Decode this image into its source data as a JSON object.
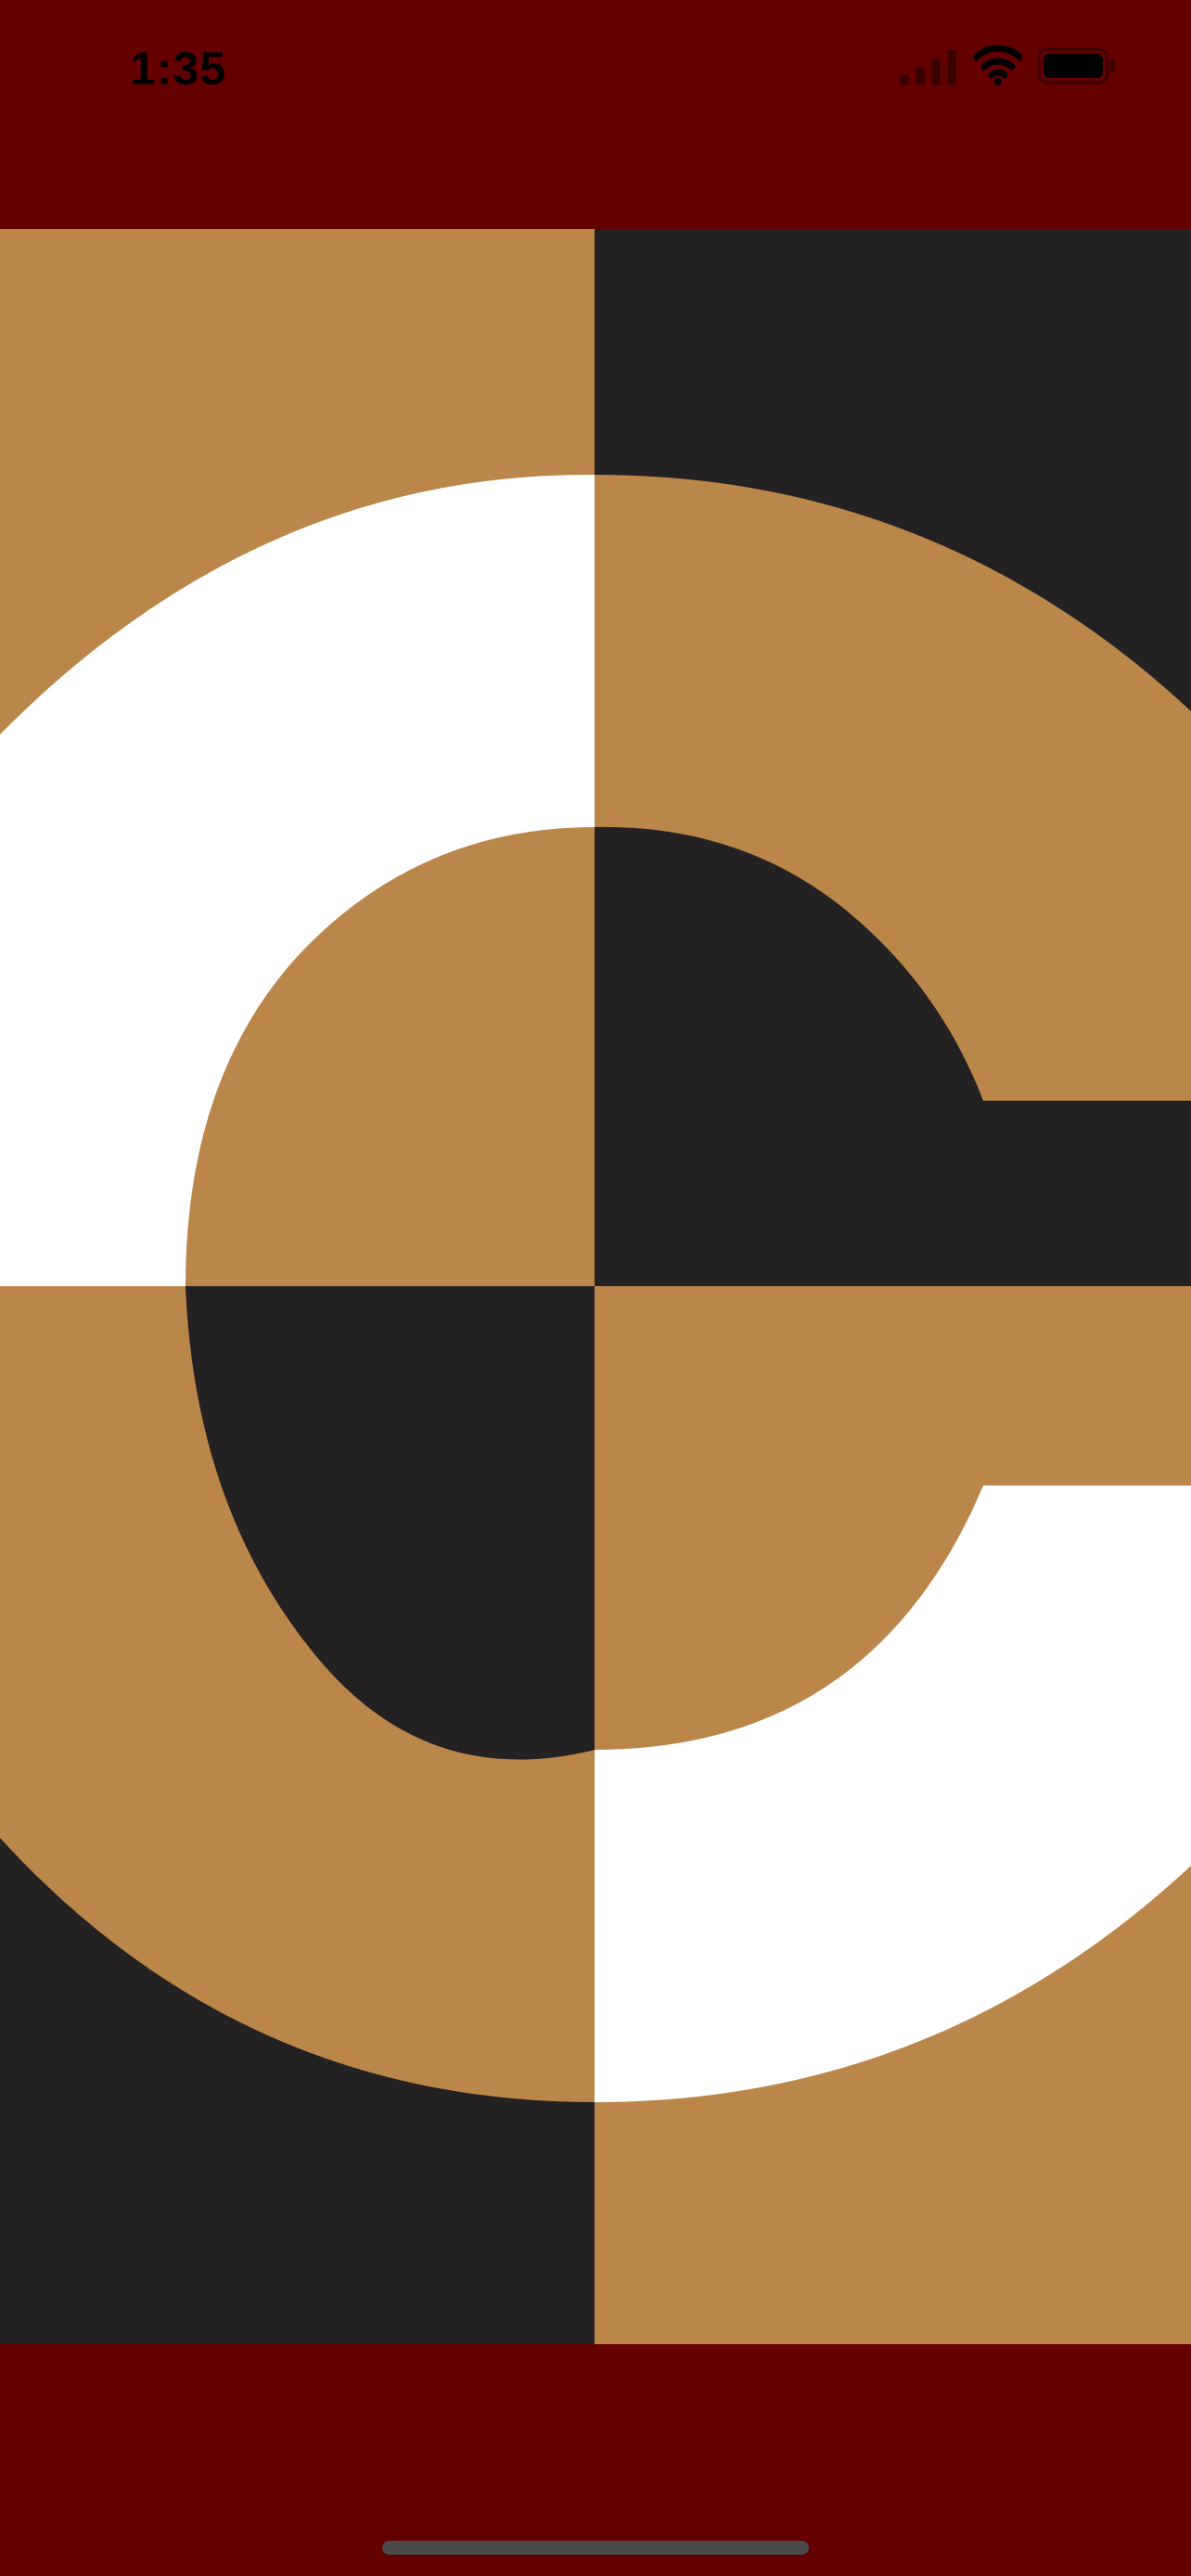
{
  "status_bar": {
    "time": "1:35",
    "icons": [
      "cellular-signal-icon",
      "wifi-icon",
      "battery-icon"
    ]
  },
  "colors": {
    "background": "#650000",
    "gold": "#BB8649",
    "dark": "#232122",
    "white": "#FFFFFF",
    "home_indicator": "#4A4A4A"
  },
  "artwork": {
    "subject": "letter-c-quadrant-artwork",
    "quadrant_colors": {
      "top_left": "gold",
      "top_right": "dark",
      "bottom_left": "dark",
      "bottom_right": "gold"
    }
  }
}
